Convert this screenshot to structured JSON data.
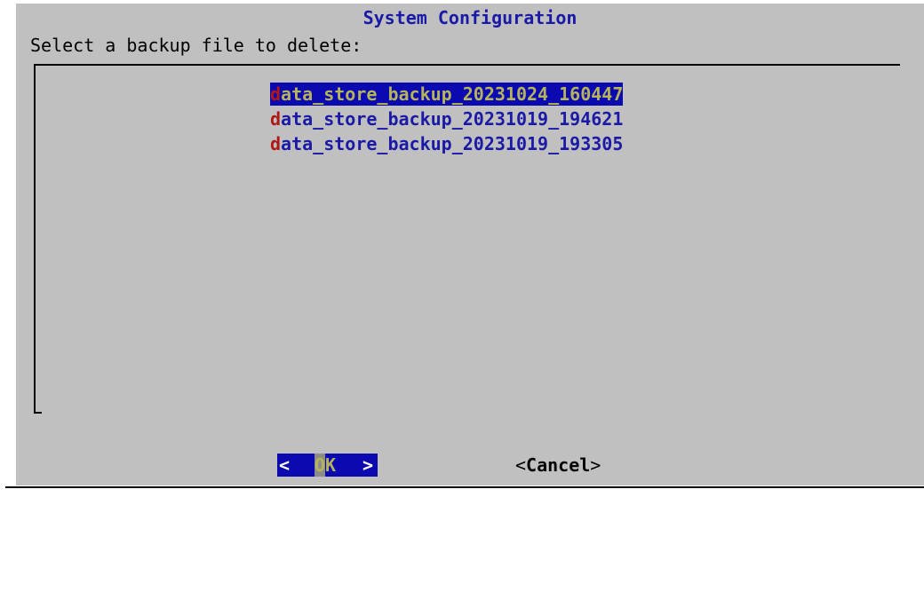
{
  "dialog": {
    "title": "System Configuration",
    "prompt": "Select a backup file to delete:"
  },
  "list": {
    "items": [
      {
        "hotkey": "d",
        "rest": "ata_store_backup_20231024_160447",
        "selected": true
      },
      {
        "hotkey": "d",
        "rest": "ata_store_backup_20231019_194621",
        "selected": false
      },
      {
        "hotkey": "d",
        "rest": "ata_store_backup_20231019_193305",
        "selected": false
      }
    ]
  },
  "buttons": {
    "ok": {
      "left": "<",
      "label": "OK",
      "right": ">"
    },
    "cancel": {
      "open": "<",
      "label": "Cancel",
      "close": ">"
    }
  },
  "colors": {
    "background": "#c0c0c0",
    "title": "#1a1aa6",
    "selection": "#0a0ab0",
    "hotkey": "#b01818",
    "selected_text": "#b7b35a"
  }
}
